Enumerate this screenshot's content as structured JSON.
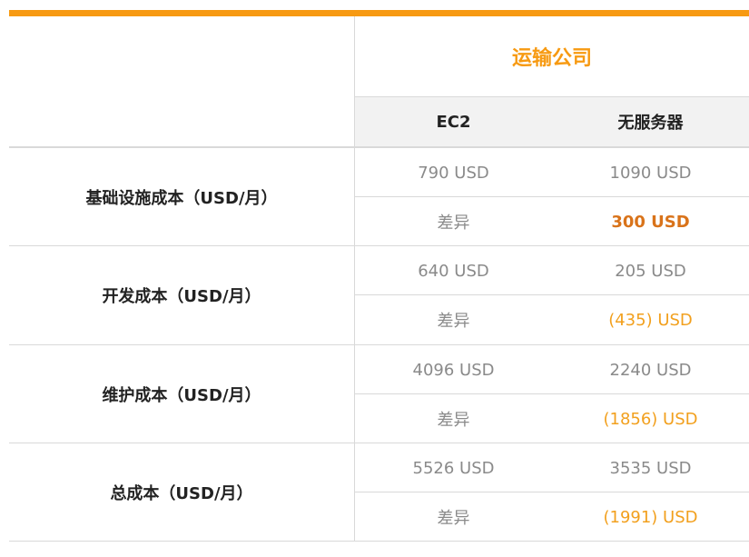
{
  "table": {
    "company": "运输公司",
    "columns": [
      "EC2",
      "无服务器"
    ],
    "diff_label": "差异",
    "rows": [
      {
        "label": "基础设施成本（USD/月）",
        "ec2": "790 USD",
        "serverless": "1090 USD",
        "difference": "300 USD"
      },
      {
        "label": "开发成本（USD/月）",
        "ec2": "640 USD",
        "serverless": "205 USD",
        "difference": "(435) USD"
      },
      {
        "label": "维护成本（USD/月）",
        "ec2": "4096 USD",
        "serverless": "2240 USD",
        "difference": "(1856) USD"
      },
      {
        "label": "总成本（USD/月）",
        "ec2": "5526 USD",
        "serverless": "3535 USD",
        "difference": "(1991) USD"
      }
    ]
  },
  "colors": {
    "accent": "#f79a12",
    "difference_positive": "#d9731a",
    "difference_negative": "#f2a01e"
  }
}
